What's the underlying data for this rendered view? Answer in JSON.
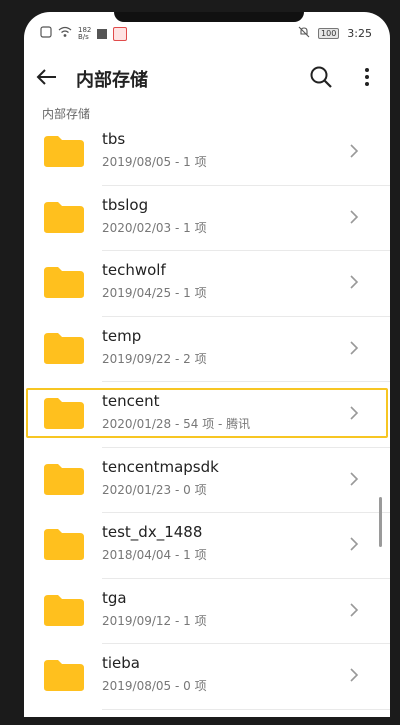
{
  "status": {
    "speed_top": "182",
    "speed_unit": "B/s",
    "time": "3:25",
    "battery": "100"
  },
  "appbar": {
    "title": "内部存储"
  },
  "section_label": "内部存储",
  "folders": [
    {
      "name": "tbs",
      "meta": "2019/08/05 - 1 项"
    },
    {
      "name": "tbslog",
      "meta": "2020/02/03 - 1 项"
    },
    {
      "name": "techwolf",
      "meta": "2019/04/25 - 1 项"
    },
    {
      "name": "temp",
      "meta": "2019/09/22 - 2 项"
    },
    {
      "name": "tencent",
      "meta": "2020/01/28 - 54 项 - 腾讯"
    },
    {
      "name": "tencentmapsdk",
      "meta": "2020/01/23 - 0 项"
    },
    {
      "name": "test_dx_1488",
      "meta": "2018/04/04 - 1 项"
    },
    {
      "name": "tga",
      "meta": "2019/09/12 - 1 项"
    },
    {
      "name": "tieba",
      "meta": "2019/08/05 - 0 项"
    }
  ],
  "colors": {
    "folder": "#FFC01E",
    "highlight": "#F7C623"
  },
  "icons": {
    "back": "arrow-left",
    "search": "magnifier",
    "more": "vertical-dots",
    "folder": "folder",
    "chevron": "chevron-right"
  }
}
